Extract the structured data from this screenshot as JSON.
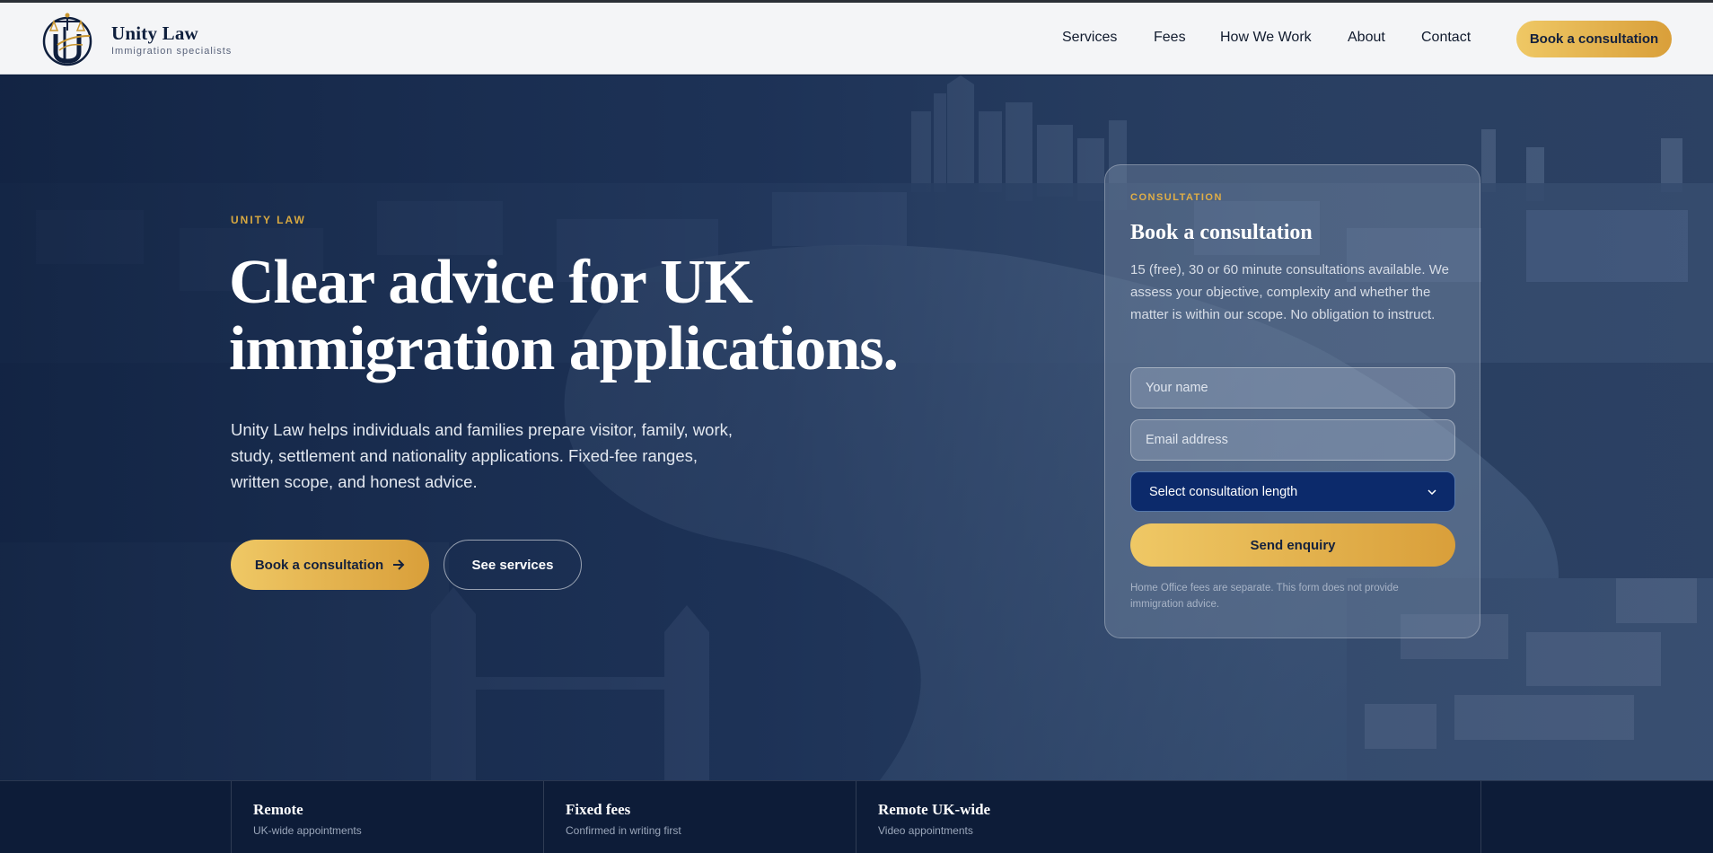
{
  "header": {
    "brand_name": "Unity Law",
    "brand_tagline": "Immigration specialists",
    "nav": [
      "Services",
      "Fees",
      "How We Work",
      "About",
      "Contact"
    ],
    "cta_label": "Book a consultation"
  },
  "hero": {
    "eyebrow": "UNITY LAW",
    "title": "Clear advice for UK immigration applications.",
    "lede": "Unity Law helps individuals and families prepare visitor, family, work, study, settlement and nationality applications. Fixed-fee ranges, written scope, and honest advice.",
    "primary_label": "Book a consultation",
    "secondary_label": "See services"
  },
  "card": {
    "eyebrow": "CONSULTATION",
    "title": "Book a consultation",
    "description": "15 (free), 30 or 60 minute consultations available. We assess your objective, complexity and whether the matter is within our scope. No obligation to instruct.",
    "name_placeholder": "Your name",
    "email_placeholder": "Email address",
    "select_value": "Select consultation length",
    "submit_label": "Send enquiry",
    "note": "Home Office fees are separate. This form does not provide immigration advice."
  },
  "features": [
    {
      "title": "Remote",
      "subtitle": "UK-wide appointments"
    },
    {
      "title": "Fixed fees",
      "subtitle": "Confirmed in writing first"
    },
    {
      "title": "Remote UK-wide",
      "subtitle": "Video appointments"
    }
  ],
  "icons": {
    "logo": "scales-of-justice-logo-icon",
    "arrow": "arrow-right-icon",
    "select": "chevron-down-icon"
  },
  "colors": {
    "navy": "#0f1f3d",
    "gold": "#d99f3a",
    "gold_light": "#efc865"
  }
}
